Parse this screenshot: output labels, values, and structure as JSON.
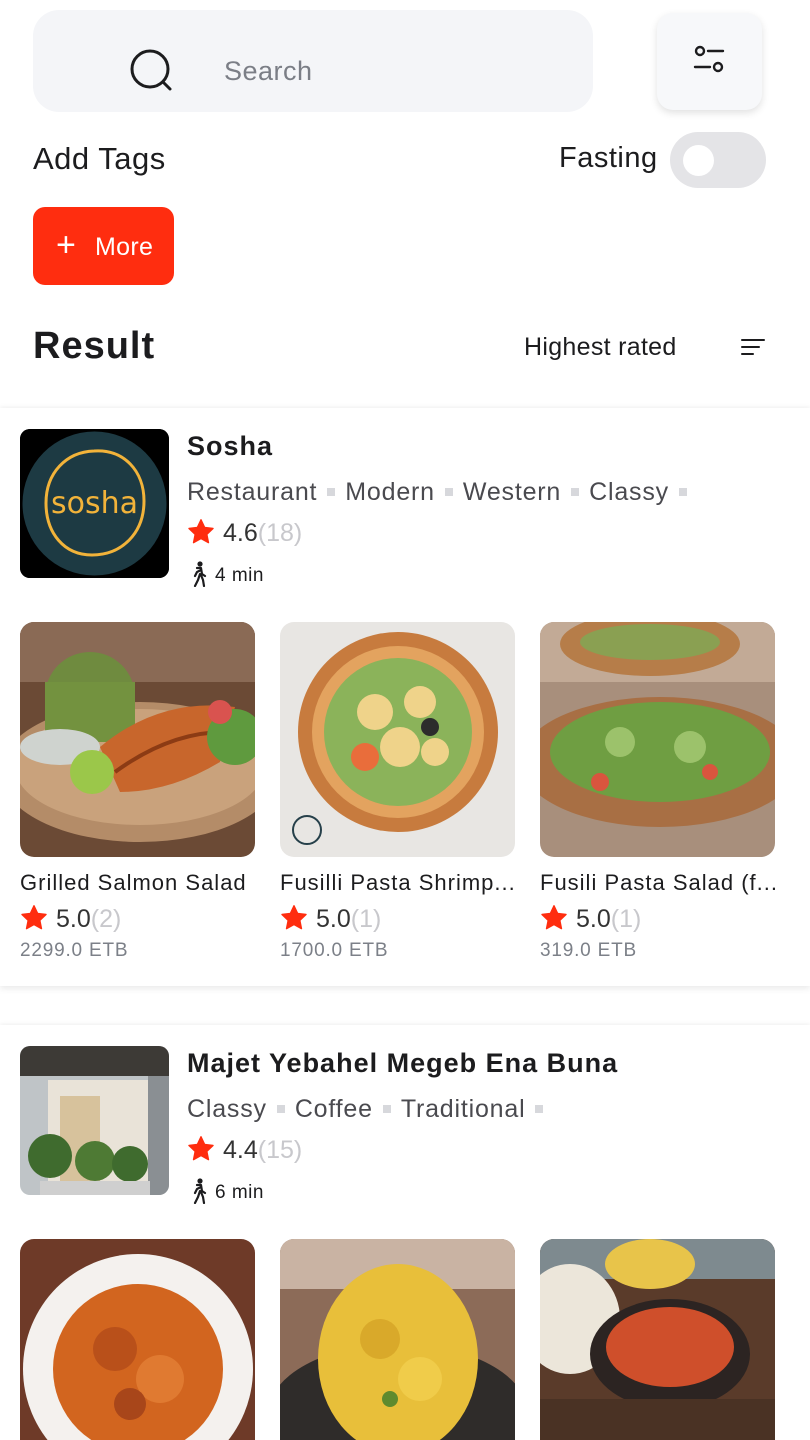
{
  "search": {
    "placeholder": "Search"
  },
  "filters": {
    "add_tags_label": "Add Tags",
    "fasting_label": "Fasting",
    "fasting_on": false,
    "more_label": "More"
  },
  "results": {
    "title": "Result",
    "sort_label": "Highest rated"
  },
  "colors": {
    "accent": "#ff2d0f",
    "star": "#ff2d0f",
    "muted": "#c8c8cc"
  },
  "restaurants": [
    {
      "name": "Sosha",
      "logo_text": "sosha",
      "tags": [
        "Restaurant",
        "Modern",
        "Western",
        "Classy"
      ],
      "rating": "4.6",
      "rating_count": "(18)",
      "walk_time": "4 min",
      "dishes": [
        {
          "name": "Grilled Salmon Salad",
          "rating": "5.0",
          "rating_count": "(2)",
          "price": "2299.0 ETB"
        },
        {
          "name": "Fusilli Pasta Shrimp...",
          "rating": "5.0",
          "rating_count": "(1)",
          "price": "1700.0 ETB"
        },
        {
          "name": "Fusili Pasta Salad (f...",
          "rating": "5.0",
          "rating_count": "(1)",
          "price": "319.0 ETB"
        }
      ]
    },
    {
      "name": "Majet Yebahel Megeb Ena Buna",
      "tags": [
        "Classy",
        "Coffee",
        "Traditional"
      ],
      "rating": "4.4",
      "rating_count": "(15)",
      "walk_time": "6 min",
      "dishes": [
        {},
        {},
        {}
      ]
    }
  ]
}
